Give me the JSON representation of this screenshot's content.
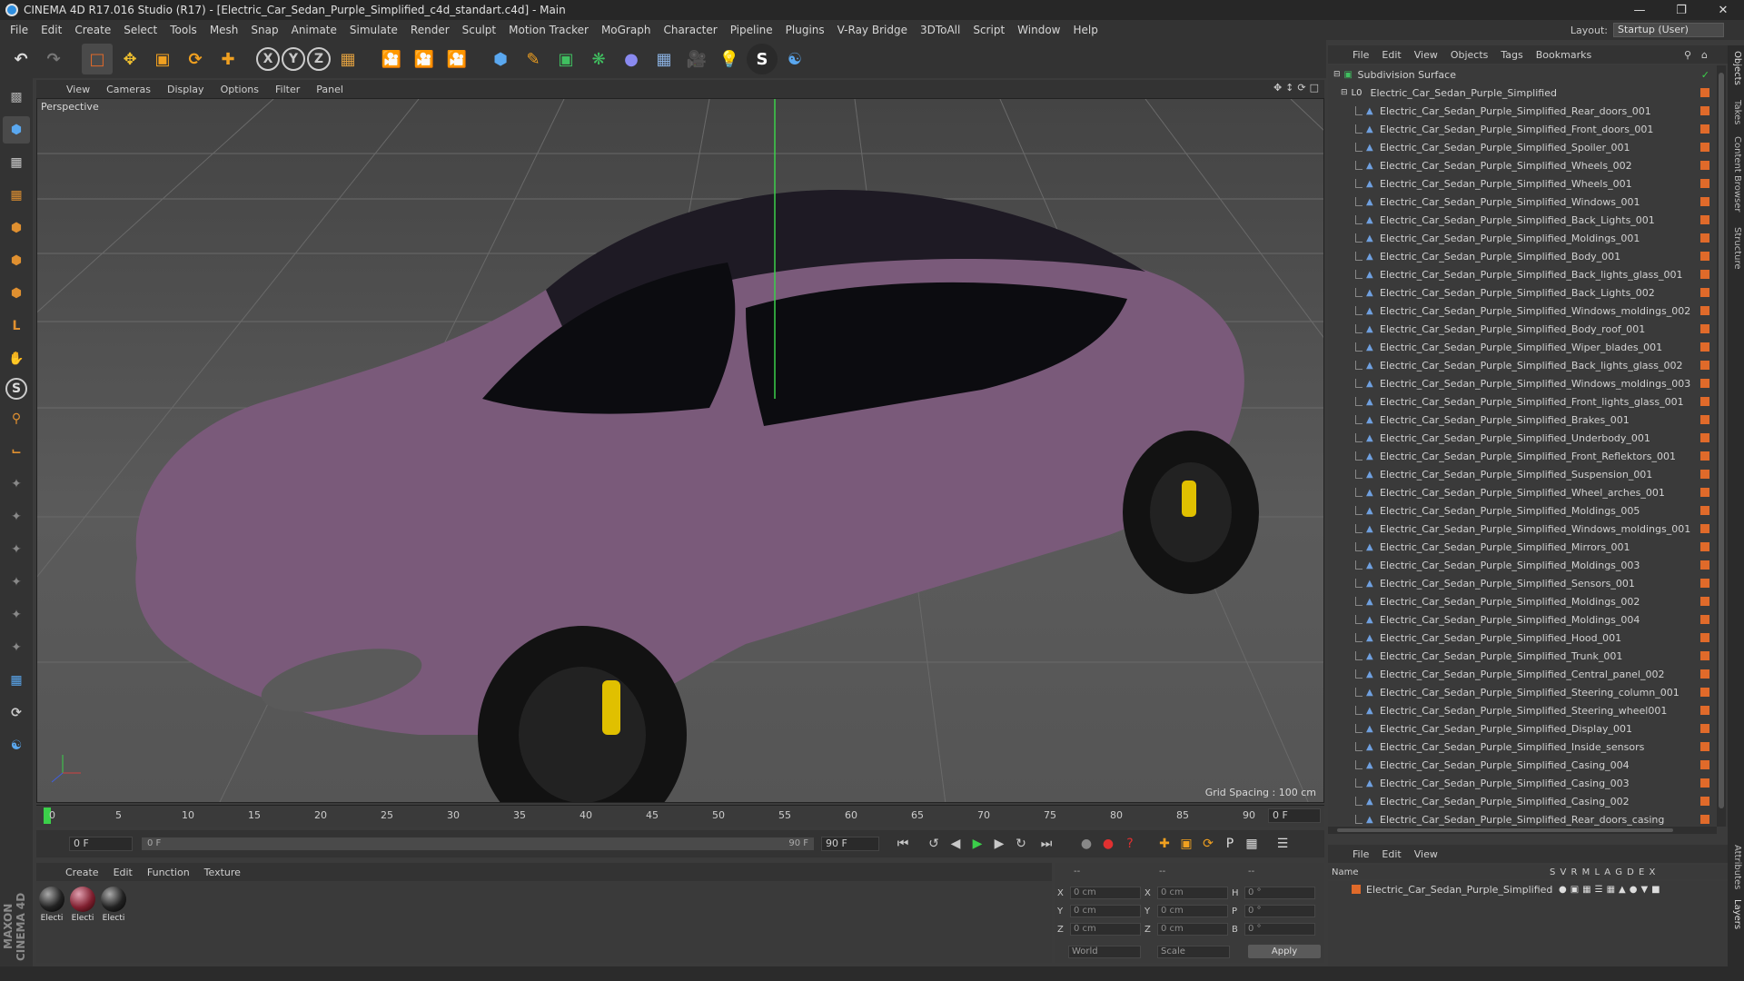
{
  "title": "CINEMA 4D R17.016 Studio (R17) - [Electric_Car_Sedan_Purple_Simplified_c4d_standart.c4d] - Main",
  "menubar": [
    "File",
    "Edit",
    "Create",
    "Select",
    "Tools",
    "Mesh",
    "Snap",
    "Animate",
    "Simulate",
    "Render",
    "Sculpt",
    "Motion Tracker",
    "MoGraph",
    "Character",
    "Pipeline",
    "Plugins",
    "V-Ray Bridge",
    "3DToAll",
    "Script",
    "Window",
    "Help"
  ],
  "layout": {
    "label": "Layout:",
    "value": "Startup (User)"
  },
  "toolbar": {
    "x_axis": "X",
    "y_axis": "Y",
    "z_axis": "Z"
  },
  "viewport": {
    "menu": [
      "View",
      "Cameras",
      "Display",
      "Options",
      "Filter",
      "Panel"
    ],
    "label": "Perspective",
    "grid_spacing": "Grid Spacing : 100 cm"
  },
  "timeline": {
    "ticks": [
      "0",
      "5",
      "10",
      "15",
      "20",
      "25",
      "30",
      "35",
      "40",
      "45",
      "50",
      "55",
      "60",
      "65",
      "70",
      "75",
      "80",
      "85",
      "90"
    ],
    "current_frame": "0 F"
  },
  "playback": {
    "start": "0 F",
    "range_start": "0 F",
    "range_end": "90 F",
    "end": "90 F"
  },
  "materials": {
    "menu": [
      "Create",
      "Edit",
      "Function",
      "Texture"
    ],
    "items": [
      "Electi",
      "Electi",
      "Electi"
    ]
  },
  "coordinates": {
    "col_headers": [
      "--",
      "--",
      "--"
    ],
    "rows": [
      {
        "a": "X",
        "av": "0 cm",
        "b": "X",
        "bv": "0 cm",
        "c": "H",
        "cv": "0 °"
      },
      {
        "a": "Y",
        "av": "0 cm",
        "b": "Y",
        "bv": "0 cm",
        "c": "P",
        "cv": "0 °"
      },
      {
        "a": "Z",
        "av": "0 cm",
        "b": "Z",
        "bv": "0 cm",
        "c": "B",
        "cv": "0 °"
      }
    ],
    "world": "World",
    "scale": "Scale",
    "apply": "Apply"
  },
  "object_manager": {
    "menu": [
      "File",
      "Edit",
      "View",
      "Objects",
      "Tags",
      "Bookmarks"
    ],
    "root": "Subdivision Surface",
    "group": "Electric_Car_Sedan_Purple_Simplified",
    "objects": [
      "Electric_Car_Sedan_Purple_Simplified_Rear_doors_001",
      "Electric_Car_Sedan_Purple_Simplified_Front_doors_001",
      "Electric_Car_Sedan_Purple_Simplified_Spoiler_001",
      "Electric_Car_Sedan_Purple_Simplified_Wheels_002",
      "Electric_Car_Sedan_Purple_Simplified_Wheels_001",
      "Electric_Car_Sedan_Purple_Simplified_Windows_001",
      "Electric_Car_Sedan_Purple_Simplified_Back_Lights_001",
      "Electric_Car_Sedan_Purple_Simplified_Moldings_001",
      "Electric_Car_Sedan_Purple_Simplified_Body_001",
      "Electric_Car_Sedan_Purple_Simplified_Back_lights_glass_001",
      "Electric_Car_Sedan_Purple_Simplified_Back_Lights_002",
      "Electric_Car_Sedan_Purple_Simplified_Windows_moldings_002",
      "Electric_Car_Sedan_Purple_Simplified_Body_roof_001",
      "Electric_Car_Sedan_Purple_Simplified_Wiper_blades_001",
      "Electric_Car_Sedan_Purple_Simplified_Back_lights_glass_002",
      "Electric_Car_Sedan_Purple_Simplified_Windows_moldings_003",
      "Electric_Car_Sedan_Purple_Simplified_Front_lights_glass_001",
      "Electric_Car_Sedan_Purple_Simplified_Brakes_001",
      "Electric_Car_Sedan_Purple_Simplified_Underbody_001",
      "Electric_Car_Sedan_Purple_Simplified_Front_Reflektors_001",
      "Electric_Car_Sedan_Purple_Simplified_Suspension_001",
      "Electric_Car_Sedan_Purple_Simplified_Wheel_arches_001",
      "Electric_Car_Sedan_Purple_Simplified_Moldings_005",
      "Electric_Car_Sedan_Purple_Simplified_Windows_moldings_001",
      "Electric_Car_Sedan_Purple_Simplified_Mirrors_001",
      "Electric_Car_Sedan_Purple_Simplified_Moldings_003",
      "Electric_Car_Sedan_Purple_Simplified_Sensors_001",
      "Electric_Car_Sedan_Purple_Simplified_Moldings_002",
      "Electric_Car_Sedan_Purple_Simplified_Moldings_004",
      "Electric_Car_Sedan_Purple_Simplified_Hood_001",
      "Electric_Car_Sedan_Purple_Simplified_Trunk_001",
      "Electric_Car_Sedan_Purple_Simplified_Central_panel_002",
      "Electric_Car_Sedan_Purple_Simplified_Steering_column_001",
      "Electric_Car_Sedan_Purple_Simplified_Steering_wheel001",
      "Electric_Car_Sedan_Purple_Simplified_Display_001",
      "Electric_Car_Sedan_Purple_Simplified_Inside_sensors",
      "Electric_Car_Sedan_Purple_Simplified_Casing_004",
      "Electric_Car_Sedan_Purple_Simplified_Casing_003",
      "Electric_Car_Sedan_Purple_Simplified_Casing_002",
      "Electric_Car_Sedan_Purple_Simplified_Rear_doors_casing"
    ]
  },
  "layer_manager": {
    "menu": [
      "File",
      "Edit",
      "View"
    ],
    "header_name": "Name",
    "header_cols": "S V R M L A G D E X",
    "layer": "Electric_Car_Sedan_Purple_Simplified"
  },
  "side_tabs": [
    "Objects",
    "Takes",
    "Content Browser",
    "Structure",
    "Attributes",
    "Layers"
  ],
  "brand": "MAXON CINEMA 4D",
  "colors": {
    "accent": "#2f8fe0",
    "tag": "#e06a2a",
    "car": "#7a5a7a"
  }
}
